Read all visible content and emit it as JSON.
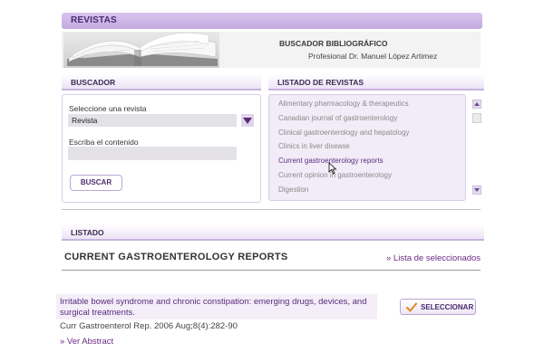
{
  "top_bar": {
    "title": "REVISTAS"
  },
  "header": {
    "title": "BUSCADOR BIBLIOGRÁFICO",
    "subtitle": "Profesional Dr. Manuel López Artimez"
  },
  "buscador": {
    "section_label": "BUSCADOR",
    "select_label": "Seleccione una revista",
    "select_value": "Revista",
    "content_label": "Escriba el contenido",
    "content_value": "",
    "search_button": "BUSCAR"
  },
  "listado_revistas": {
    "section_label": "LISTADO DE REVISTAS",
    "items": [
      {
        "label": "Alimentary pharmacology & therapeutics",
        "selected": false
      },
      {
        "label": "Canadian journal of gastroenterology",
        "selected": false
      },
      {
        "label": "Clinical gastroenterology and hepatology",
        "selected": false
      },
      {
        "label": "Clinics in liver disease",
        "selected": false
      },
      {
        "label": "Current gastroenterology reports",
        "selected": true
      },
      {
        "label": "Current opinion in gastroenterology",
        "selected": false
      },
      {
        "label": "Digestion",
        "selected": false
      }
    ]
  },
  "listado": {
    "section_label": "LISTADO",
    "journal_title": "CURRENT GASTROENTEROLOGY REPORTS",
    "selected_link": "» Lista de seleccionados",
    "results": [
      {
        "title": "Irritable bowel syndrome and chronic constipation: emerging drugs, devices, and surgical treatments.",
        "reference": "Curr Gastroenterol Rep. 2006 Aug;8(4):282-90",
        "abstract_link": "» Ver Abstract",
        "select_button": "SELECCIONAR"
      }
    ]
  },
  "colors": {
    "accent": "#c3a9e0",
    "link": "#6a2a82",
    "selected_item": "#5d2f83"
  }
}
